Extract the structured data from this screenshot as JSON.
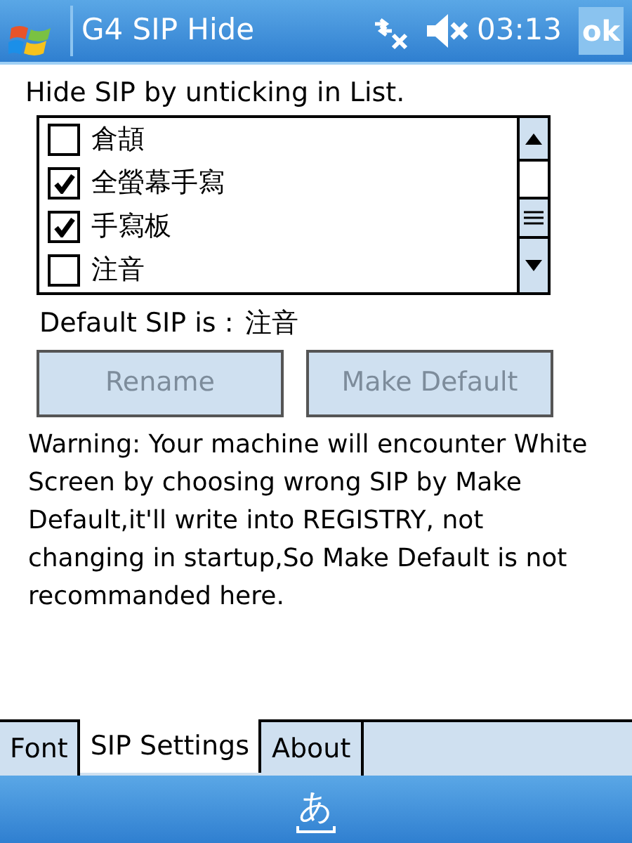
{
  "title_bar": {
    "title": "G4 SIP Hide",
    "time": "03:13",
    "ok": "ok"
  },
  "instruction": "Hide SIP by unticking in List.",
  "sip_list": [
    {
      "label": "倉頡",
      "checked": false
    },
    {
      "label": "全螢幕手寫",
      "checked": true
    },
    {
      "label": "手寫板",
      "checked": true
    },
    {
      "label": "注音",
      "checked": false
    }
  ],
  "default_sip": {
    "label": "Default SIP is :",
    "value": "注音"
  },
  "buttons": [
    {
      "label": "Rename",
      "disabled": true
    },
    {
      "label": "Make Default",
      "disabled": true
    }
  ],
  "warning": "Warning: Your machine will encounter White Screen by choosing wrong SIP by Make Default,it'll write into REGISTRY, not changing in startup,So Make Default is not recommanded here.",
  "tabs": [
    {
      "label": "Font",
      "selected": false
    },
    {
      "label": "SIP Settings",
      "selected": true
    },
    {
      "label": "About",
      "selected": false
    }
  ],
  "input_panel": {
    "glyph": "あ"
  }
}
